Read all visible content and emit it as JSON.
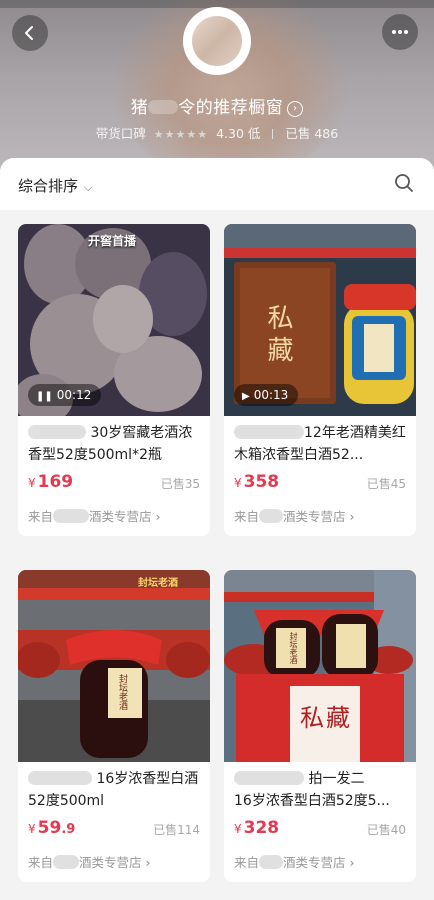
{
  "header": {
    "shop_title_prefix": "猪",
    "shop_title_suffix": "令的推荐橱窗",
    "reputation_label": "带货口碑",
    "rating": "4.30",
    "rating_level": "低",
    "sold_text": "已售 486"
  },
  "sort": {
    "label": "综合排序"
  },
  "products": [
    {
      "title": "30岁窖藏老酒浓香型52度500ml*2瓶",
      "price_symbol": "¥",
      "price": "169",
      "sold": "已售35",
      "store_prefix": "来自",
      "store_suffix": "酒类专营店",
      "video_time": "00:12",
      "image_tag": "开窖首播"
    },
    {
      "title": "12年老酒精美红木箱浓香型白酒52...",
      "price_symbol": "¥",
      "price": "358",
      "sold": "已售45",
      "store_prefix": "来自",
      "store_suffix": "酒类专营店",
      "video_time": "00:13",
      "box_text": "私藏"
    },
    {
      "title": "16岁浓香型白酒52度500ml",
      "price_symbol": "¥",
      "price": "59",
      "price_decimal": ".9",
      "sold": "已售114",
      "store_prefix": "来自",
      "store_suffix": "酒类专营店",
      "jar_label": "封坛老酒",
      "banner_text": "封坛老酒"
    },
    {
      "title_line1": "拍一发二",
      "title_line2": "16岁浓香型白酒52度5...",
      "price_symbol": "¥",
      "price": "328",
      "sold": "已售40",
      "store_prefix": "来自",
      "store_suffix": "酒类专营店",
      "box_text": "私藏",
      "jar_label": "封坛老酒"
    }
  ],
  "colors": {
    "price_red": "#e8384f",
    "sold_gray": "#a8a8a8"
  }
}
